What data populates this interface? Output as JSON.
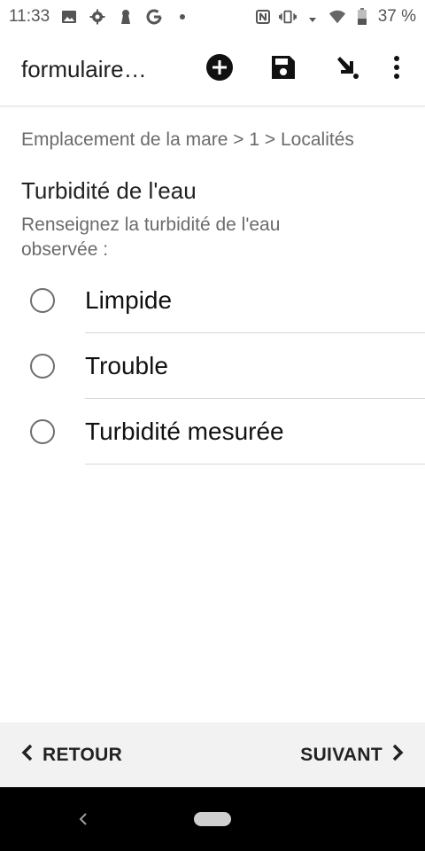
{
  "status_bar": {
    "time": "11:33",
    "left_icons": [
      "image-icon",
      "settings-icon",
      "keyhole-icon",
      "google-g-icon",
      "dot-icon"
    ],
    "right_icons": [
      "nfc-icon",
      "vibrate-icon",
      "data-arrows-icon",
      "wifi-icon",
      "battery-icon"
    ],
    "battery_text": "37 %"
  },
  "toolbar": {
    "title": "formulaire…",
    "actions": [
      "add-circle-icon",
      "save-icon",
      "send-arrow-icon",
      "more-vert-icon"
    ]
  },
  "breadcrumb": "Emplacement de la mare > 1 > Localités",
  "question": {
    "title": "Turbidité de l'eau",
    "hint": "Renseignez la turbidité de l'eau observée :",
    "options": [
      {
        "label": "Limpide",
        "selected": false
      },
      {
        "label": "Trouble",
        "selected": false
      },
      {
        "label": "Turbidité mesurée",
        "selected": false
      }
    ]
  },
  "bottom_nav": {
    "back_label": "RETOUR",
    "next_label": "SUIVANT"
  },
  "colors": {
    "toolbar_bg": "#ffffff",
    "bottom_nav_bg": "#f2f2f2",
    "system_nav_bg": "#000000",
    "secondary_text": "#6b6b6b"
  }
}
